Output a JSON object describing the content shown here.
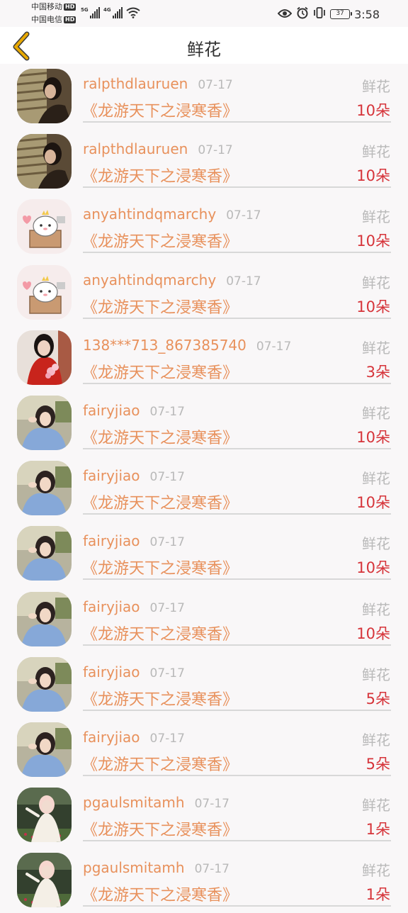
{
  "status_bar": {
    "carrier1": "中国移动",
    "carrier2": "中国电信",
    "hd_badge": "HD",
    "net1": "5G",
    "net2": "4G",
    "battery": "37",
    "time": "3:58",
    "icons": [
      "eye-icon",
      "alarm-icon",
      "vibrate-icon",
      "wifi-icon",
      "battery-icon"
    ]
  },
  "nav": {
    "back_icon": "chevron-left-icon",
    "title": "鲜花"
  },
  "colors": {
    "accent": "#e8915c",
    "quantity": "#d6343a",
    "muted": "#b9b9b9",
    "back_arrow": "#e8a800"
  },
  "records": [
    {
      "avatar": "avatar-woman-window",
      "user": "ralpthdlauruen",
      "date": "07-17",
      "gift": "鲜花",
      "book": "《龙游天下之浸寒香》",
      "qty": "10朵"
    },
    {
      "avatar": "avatar-woman-window",
      "user": "ralpthdlauruen",
      "date": "07-17",
      "gift": "鲜花",
      "book": "《龙游天下之浸寒香》",
      "qty": "10朵"
    },
    {
      "avatar": "avatar-cartoon-bear",
      "user": "anyahtindqmarchy",
      "date": "07-17",
      "gift": "鲜花",
      "book": "《龙游天下之浸寒香》",
      "qty": "10朵"
    },
    {
      "avatar": "avatar-cartoon-bear",
      "user": "anyahtindqmarchy",
      "date": "07-17",
      "gift": "鲜花",
      "book": "《龙游天下之浸寒香》",
      "qty": "10朵"
    },
    {
      "avatar": "avatar-woman-red",
      "user": "138***713_867385740",
      "date": "07-17",
      "gift": "鲜花",
      "book": "《龙游天下之浸寒香》",
      "qty": "3朵"
    },
    {
      "avatar": "avatar-girl-outdoor",
      "user": "fairyjiao",
      "date": "07-17",
      "gift": "鲜花",
      "book": "《龙游天下之浸寒香》",
      "qty": "10朵"
    },
    {
      "avatar": "avatar-girl-outdoor",
      "user": "fairyjiao",
      "date": "07-17",
      "gift": "鲜花",
      "book": "《龙游天下之浸寒香》",
      "qty": "10朵"
    },
    {
      "avatar": "avatar-girl-outdoor",
      "user": "fairyjiao",
      "date": "07-17",
      "gift": "鲜花",
      "book": "《龙游天下之浸寒香》",
      "qty": "10朵"
    },
    {
      "avatar": "avatar-girl-outdoor",
      "user": "fairyjiao",
      "date": "07-17",
      "gift": "鲜花",
      "book": "《龙游天下之浸寒香》",
      "qty": "10朵"
    },
    {
      "avatar": "avatar-girl-outdoor",
      "user": "fairyjiao",
      "date": "07-17",
      "gift": "鲜花",
      "book": "《龙游天下之浸寒香》",
      "qty": "5朵"
    },
    {
      "avatar": "avatar-girl-outdoor",
      "user": "fairyjiao",
      "date": "07-17",
      "gift": "鲜花",
      "book": "《龙游天下之浸寒香》",
      "qty": "5朵"
    },
    {
      "avatar": "avatar-girl-white-dress",
      "user": "pgaulsmitamh",
      "date": "07-17",
      "gift": "鲜花",
      "book": "《龙游天下之浸寒香》",
      "qty": "1朵"
    },
    {
      "avatar": "avatar-girl-white-dress",
      "user": "pgaulsmitamh",
      "date": "07-17",
      "gift": "鲜花",
      "book": "《龙游天下之浸寒香》",
      "qty": "1朵"
    }
  ]
}
